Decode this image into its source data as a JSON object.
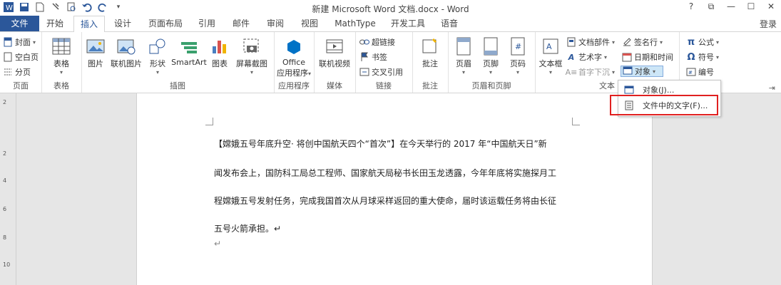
{
  "window": {
    "title": "新建 Microsoft Word 文档.docx - Word",
    "controls": [
      "?",
      "⧉",
      "—",
      "☐",
      "✕"
    ],
    "login": "登录"
  },
  "quick_access": [
    "word-icon",
    "save-icon",
    "new-doc-icon",
    "format-painter-icon",
    "print-preview-icon",
    "undo-icon",
    "redo-icon",
    "customize-icon"
  ],
  "tabs": [
    "文件",
    "开始",
    "插入",
    "设计",
    "页面布局",
    "引用",
    "邮件",
    "审阅",
    "视图",
    "MathType",
    "开发工具",
    "语音"
  ],
  "ribbon": {
    "pages": {
      "label": "页面",
      "items": [
        "封面",
        "空白页",
        "分页"
      ]
    },
    "tables": {
      "label": "表格",
      "btn": "表格"
    },
    "illustrations": {
      "label": "插图",
      "items": [
        "图片",
        "联机图片",
        "形状",
        "SmartArt",
        "图表",
        "屏幕截图"
      ]
    },
    "apps": {
      "label": "应用程序",
      "btn_line1": "Office",
      "btn_line2": "应用程序"
    },
    "media": {
      "label": "媒体",
      "btn": "联机视频"
    },
    "links": {
      "label": "链接",
      "items": [
        "超链接",
        "书签",
        "交叉引用"
      ]
    },
    "comments": {
      "label": "批注",
      "btn": "批注"
    },
    "header_footer": {
      "label": "页眉和页脚",
      "items": [
        "页眉",
        "页脚",
        "页码"
      ]
    },
    "text": {
      "label": "文本",
      "textbox": "文本框",
      "items": [
        "文档部件",
        "艺术字",
        "首字下沉",
        "签名行",
        "日期和时间",
        "对象"
      ]
    },
    "symbols": {
      "items": [
        "公式",
        "符号",
        "编号"
      ]
    }
  },
  "menu": {
    "items": [
      "对象(J)...",
      "文件中的文字(F)..."
    ]
  },
  "ruler_ticks": [
    "2",
    "2",
    "4",
    "6",
    "8",
    "10"
  ],
  "document": {
    "lines": [
      "【嫦娥五号年底升空· 将创中国航天四个“首次”】在今天举行的 2017 年“中国航天日”新",
      "闻发布会上，国防科工局总工程师、国家航天局秘书长田玉龙透露，今年年底将实施探月工",
      "程嫦娥五号发射任务，完成我国首次从月球采样返回的重大使命，届时该运载任务将由长征",
      "五号火箭承担。↵",
      "↵"
    ]
  },
  "colors": {
    "accent": "#2b579a",
    "highlight": "#e02020",
    "menu_hover": "#cde6f7"
  }
}
